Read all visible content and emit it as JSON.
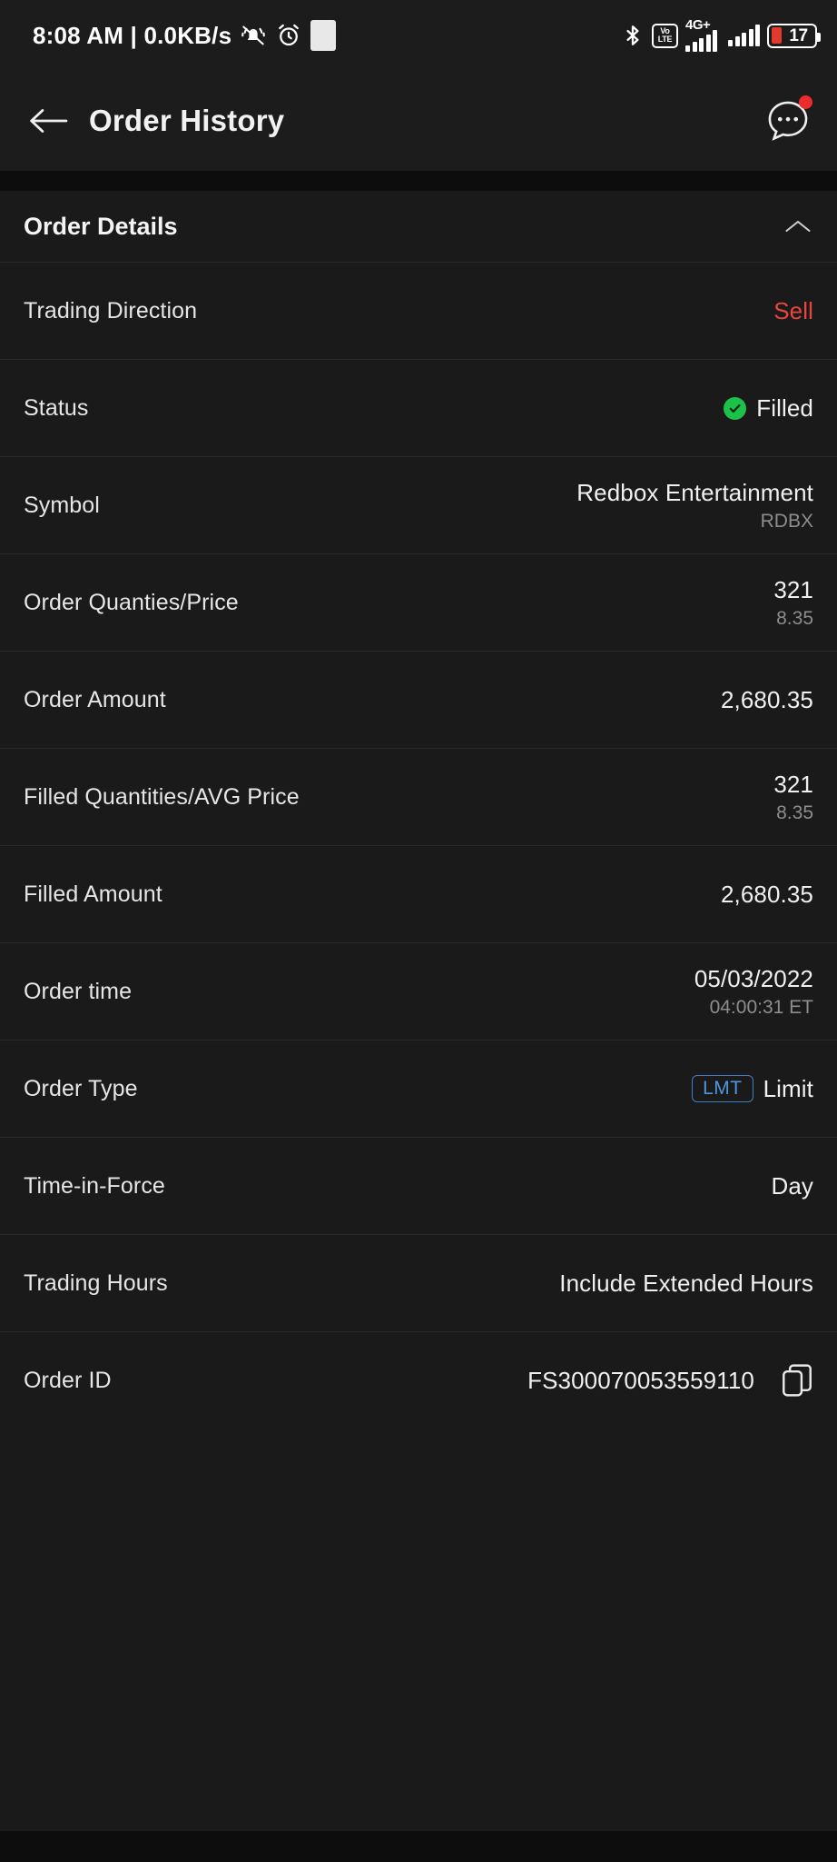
{
  "statusbar": {
    "clock": "8:08 AM | 0.0KB/s",
    "mute_icon": "bell-muted-icon",
    "alarm_icon": "alarm-clock-icon",
    "placeholder_icon": "white-square-icon",
    "bluetooth_icon": "bluetooth-icon",
    "volte_top": "Vo",
    "volte_bottom": "LTE",
    "network_label": "4G+",
    "battery_percent": "17",
    "battery_color": "#e23b2e"
  },
  "appbar": {
    "back_icon": "back-arrow-icon",
    "title": "Order History",
    "more_icon": "chat-more-icon",
    "notification_dot_color": "#ee2b2b"
  },
  "section": {
    "title": "Order Details",
    "collapse_icon": "chevron-up-icon"
  },
  "rows": [
    {
      "label": "Trading Direction",
      "value": "Sell",
      "value_style": "sell",
      "color": "#e8453c"
    },
    {
      "label": "Status",
      "value": "Filled",
      "icon": "check-circle-icon",
      "icon_color": "#1cc14a"
    },
    {
      "label": "Symbol",
      "value": "Redbox Entertainment",
      "sub": "RDBX"
    },
    {
      "label": "Order Quanties/Price",
      "value": "321",
      "sub": "8.35"
    },
    {
      "label": "Order Amount",
      "value": "2,680.35"
    },
    {
      "label": "Filled Quantities/AVG Price",
      "value": "321",
      "sub": "8.35"
    },
    {
      "label": "Filled Amount",
      "value": "2,680.35"
    },
    {
      "label": "Order time",
      "value": "05/03/2022",
      "sub": "04:00:31 ET"
    },
    {
      "label": "Order Type",
      "value": "Limit",
      "badge": "LMT",
      "badge_color": "#4d96dd"
    },
    {
      "label": "Time-in-Force",
      "value": "Day"
    },
    {
      "label": "Trading Hours",
      "value": "Include Extended Hours"
    },
    {
      "label": "Order ID",
      "value": "FS300070053559110",
      "copy_icon": "copy-icon"
    }
  ]
}
